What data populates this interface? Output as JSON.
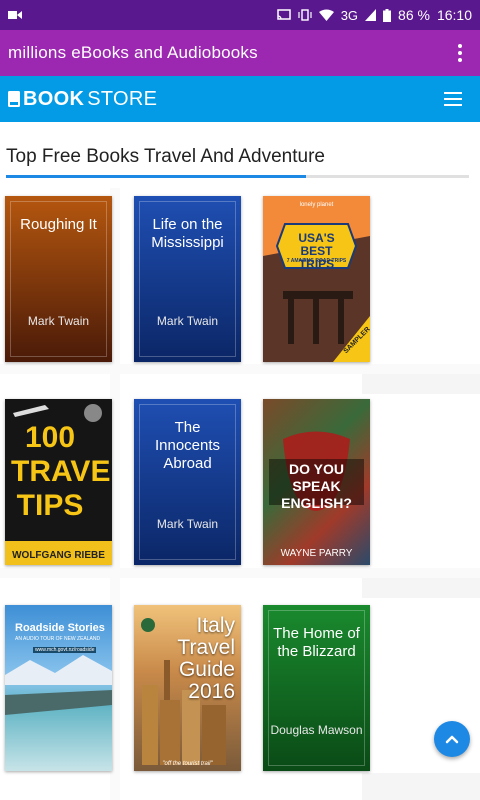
{
  "status_bar": {
    "battery_percent": "86 %",
    "time": "16:10",
    "network": "3G",
    "icons": [
      "video-camera-icon",
      "cast-icon",
      "vibrate-icon",
      "wifi-icon",
      "signal-icon",
      "battery-icon"
    ]
  },
  "app_bar": {
    "title": "millions eBooks and Audiobooks",
    "menu_icon": "overflow-menu-icon"
  },
  "store_bar": {
    "brand_bold": "BOOK",
    "brand_rest": "STORE",
    "menu_icon": "hamburger-menu-icon",
    "color": "#039be5"
  },
  "section": {
    "title": "Top Free Books Travel And Adventure"
  },
  "books": [
    {
      "title": "Roughing It",
      "author": "Mark Twain",
      "color_top": "#b5570f",
      "color_bottom": "#4a1a08"
    },
    {
      "title": "Life on the Mississippi",
      "author": "Mark Twain",
      "color_top": "#1f4fb3",
      "color_bottom": "#0b2666"
    },
    {
      "title": "USA'S BEST TRIPS",
      "subtitle": "7 AMAZING ROAD TRIPS",
      "publisher": "lonely planet",
      "badge": "SAMPLER"
    },
    {
      "title": "100 TRAVEL TIPS",
      "author": "WOLFGANG RIEBE"
    },
    {
      "title": "The Innocents Abroad",
      "author": "Mark Twain",
      "color_top": "#1f4fb3",
      "color_bottom": "#0b2666"
    },
    {
      "title": "DO YOU SPEAK ENGLISH?",
      "author": "WAYNE PARRY"
    },
    {
      "title": "Roadside Stories",
      "subtitle": "AN AUDIO TOUR OF NEW ZEALAND",
      "url": "www.mch.govt.nz/roadside"
    },
    {
      "title": "Italy Travel Guide 2016",
      "tagline": "\"off the tourist trail\""
    },
    {
      "title": "The Home of the Blizzard",
      "author": "Douglas Mawson",
      "color_top": "#1a8a2e",
      "color_bottom": "#0a4a16"
    }
  ],
  "fab": {
    "icon": "chevron-up-icon",
    "color": "#1e88e5"
  },
  "colors": {
    "status_bar": "#5a188e",
    "app_bar": "#9c27b0",
    "accent": "#1e88e5"
  }
}
